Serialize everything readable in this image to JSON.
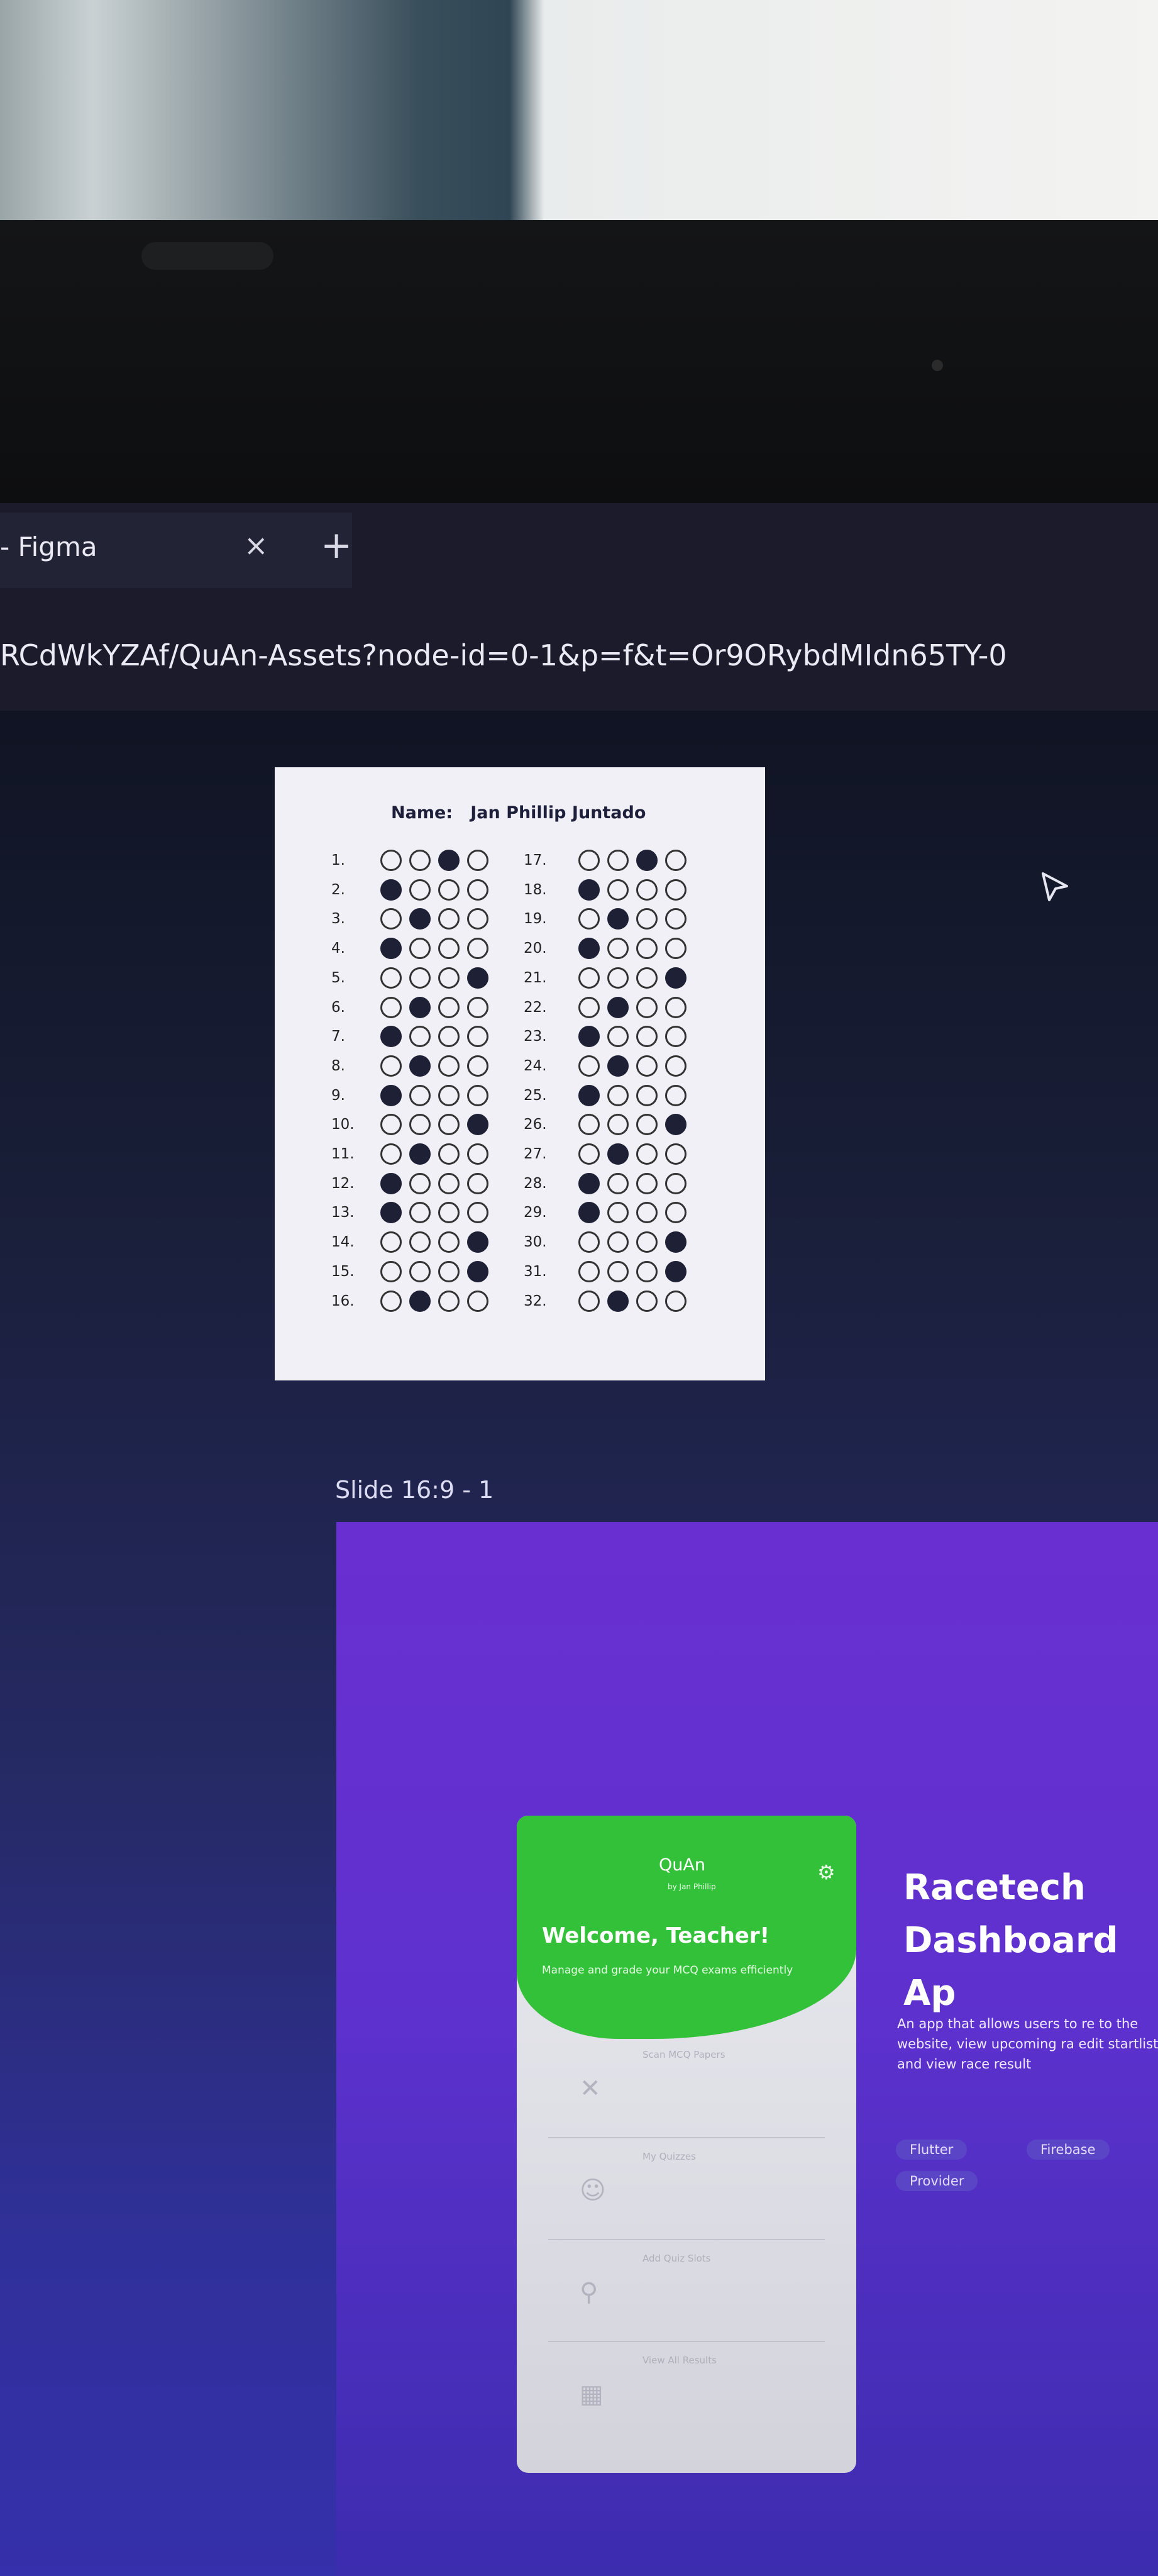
{
  "browser": {
    "tab_title": "- Figma",
    "tab_close_glyph": "×",
    "new_tab_glyph": "+",
    "url": "RCdWkYZAf/QuAn-Assets?node-id=0-1&p=f&t=Or9ORybdMIdn65TY-0"
  },
  "sheet": {
    "name_label": "Name:",
    "name_value": "Jan Phillip Juntado",
    "rows": [
      {
        "n": "1.",
        "a": 2
      },
      {
        "n": "2.",
        "a": 0
      },
      {
        "n": "3.",
        "a": 1
      },
      {
        "n": "4.",
        "a": 0
      },
      {
        "n": "5.",
        "a": 3
      },
      {
        "n": "6.",
        "a": 1
      },
      {
        "n": "7.",
        "a": 0
      },
      {
        "n": "8.",
        "a": 1
      },
      {
        "n": "9.",
        "a": 0
      },
      {
        "n": "10.",
        "a": 3
      },
      {
        "n": "11.",
        "a": 1
      },
      {
        "n": "12.",
        "a": 0
      },
      {
        "n": "13.",
        "a": 0
      },
      {
        "n": "14.",
        "a": 3
      },
      {
        "n": "15.",
        "a": 3
      },
      {
        "n": "16.",
        "a": 1
      },
      {
        "n": "17.",
        "a": 2
      },
      {
        "n": "18.",
        "a": 0
      },
      {
        "n": "19.",
        "a": 1
      },
      {
        "n": "20.",
        "a": 0
      },
      {
        "n": "21.",
        "a": 3
      },
      {
        "n": "22.",
        "a": 1
      },
      {
        "n": "23.",
        "a": 0
      },
      {
        "n": "24.",
        "a": 1
      },
      {
        "n": "25.",
        "a": 0
      },
      {
        "n": "26.",
        "a": 3
      },
      {
        "n": "27.",
        "a": 1
      },
      {
        "n": "28.",
        "a": 0
      },
      {
        "n": "29.",
        "a": 0
      },
      {
        "n": "30.",
        "a": 3
      },
      {
        "n": "31.",
        "a": 3
      },
      {
        "n": "32.",
        "a": 1
      }
    ]
  },
  "slide": {
    "label": "Slide 16:9 - 1",
    "app": {
      "title": "QuAn",
      "subtitle": "by Jan Phillip",
      "gear_glyph": "⚙",
      "welcome": "Welcome, Teacher!",
      "tagline": "Manage and grade your MCQ exams efficiently",
      "menu": [
        {
          "icon": "✕",
          "label": "Scan MCQ Papers"
        },
        {
          "icon": "☺",
          "label": "My Quizzes"
        },
        {
          "icon": "⚲",
          "label": "Add Quiz Slots"
        },
        {
          "icon": "▦",
          "label": "View All Results"
        }
      ]
    },
    "right": {
      "title": "Racetech Dashboard Ap",
      "description": "An app that allows users to re to the website, view upcoming ra edit startlist, and view race result",
      "tags": [
        "Flutter",
        "Firebase",
        "Provider"
      ]
    }
  },
  "colors": {
    "app_green": "#34c13a",
    "slide_purple": "#6a2fd0",
    "bubble_filled": "#1e2035"
  }
}
